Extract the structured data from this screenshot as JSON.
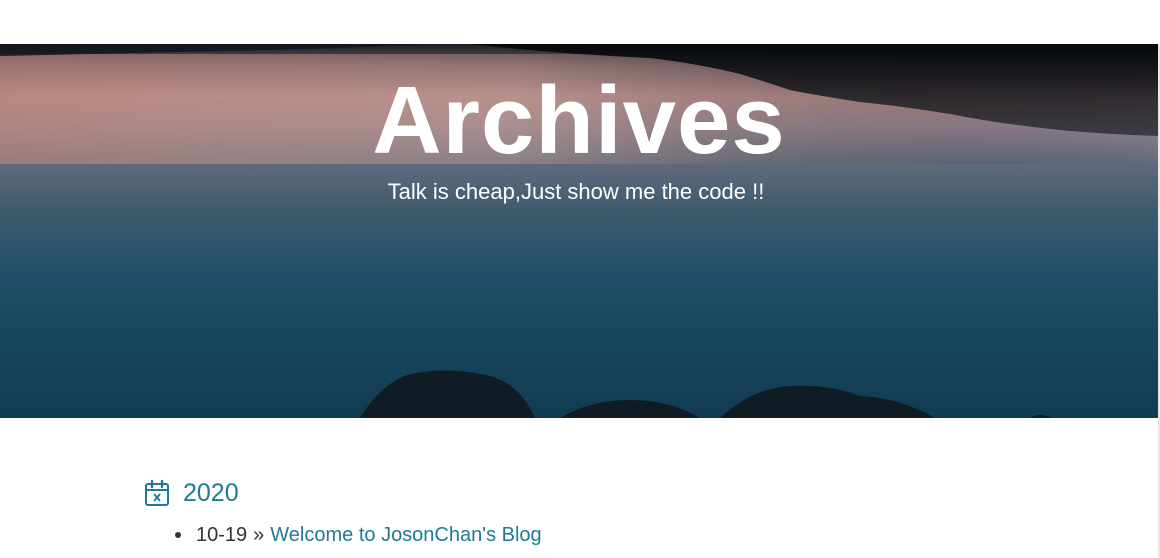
{
  "hero": {
    "title": "Archives",
    "subtitle": "Talk is cheap,Just show me the code !!"
  },
  "archive": {
    "years": [
      {
        "year": "2020",
        "icon": "calendar-x-icon",
        "posts": [
          {
            "date": "10-19",
            "separator": "»",
            "title": "Welcome to JosonChan's Blog"
          }
        ]
      }
    ]
  },
  "colors": {
    "link": "#1f7a94",
    "text": "#333333",
    "background": "#ffffff"
  }
}
